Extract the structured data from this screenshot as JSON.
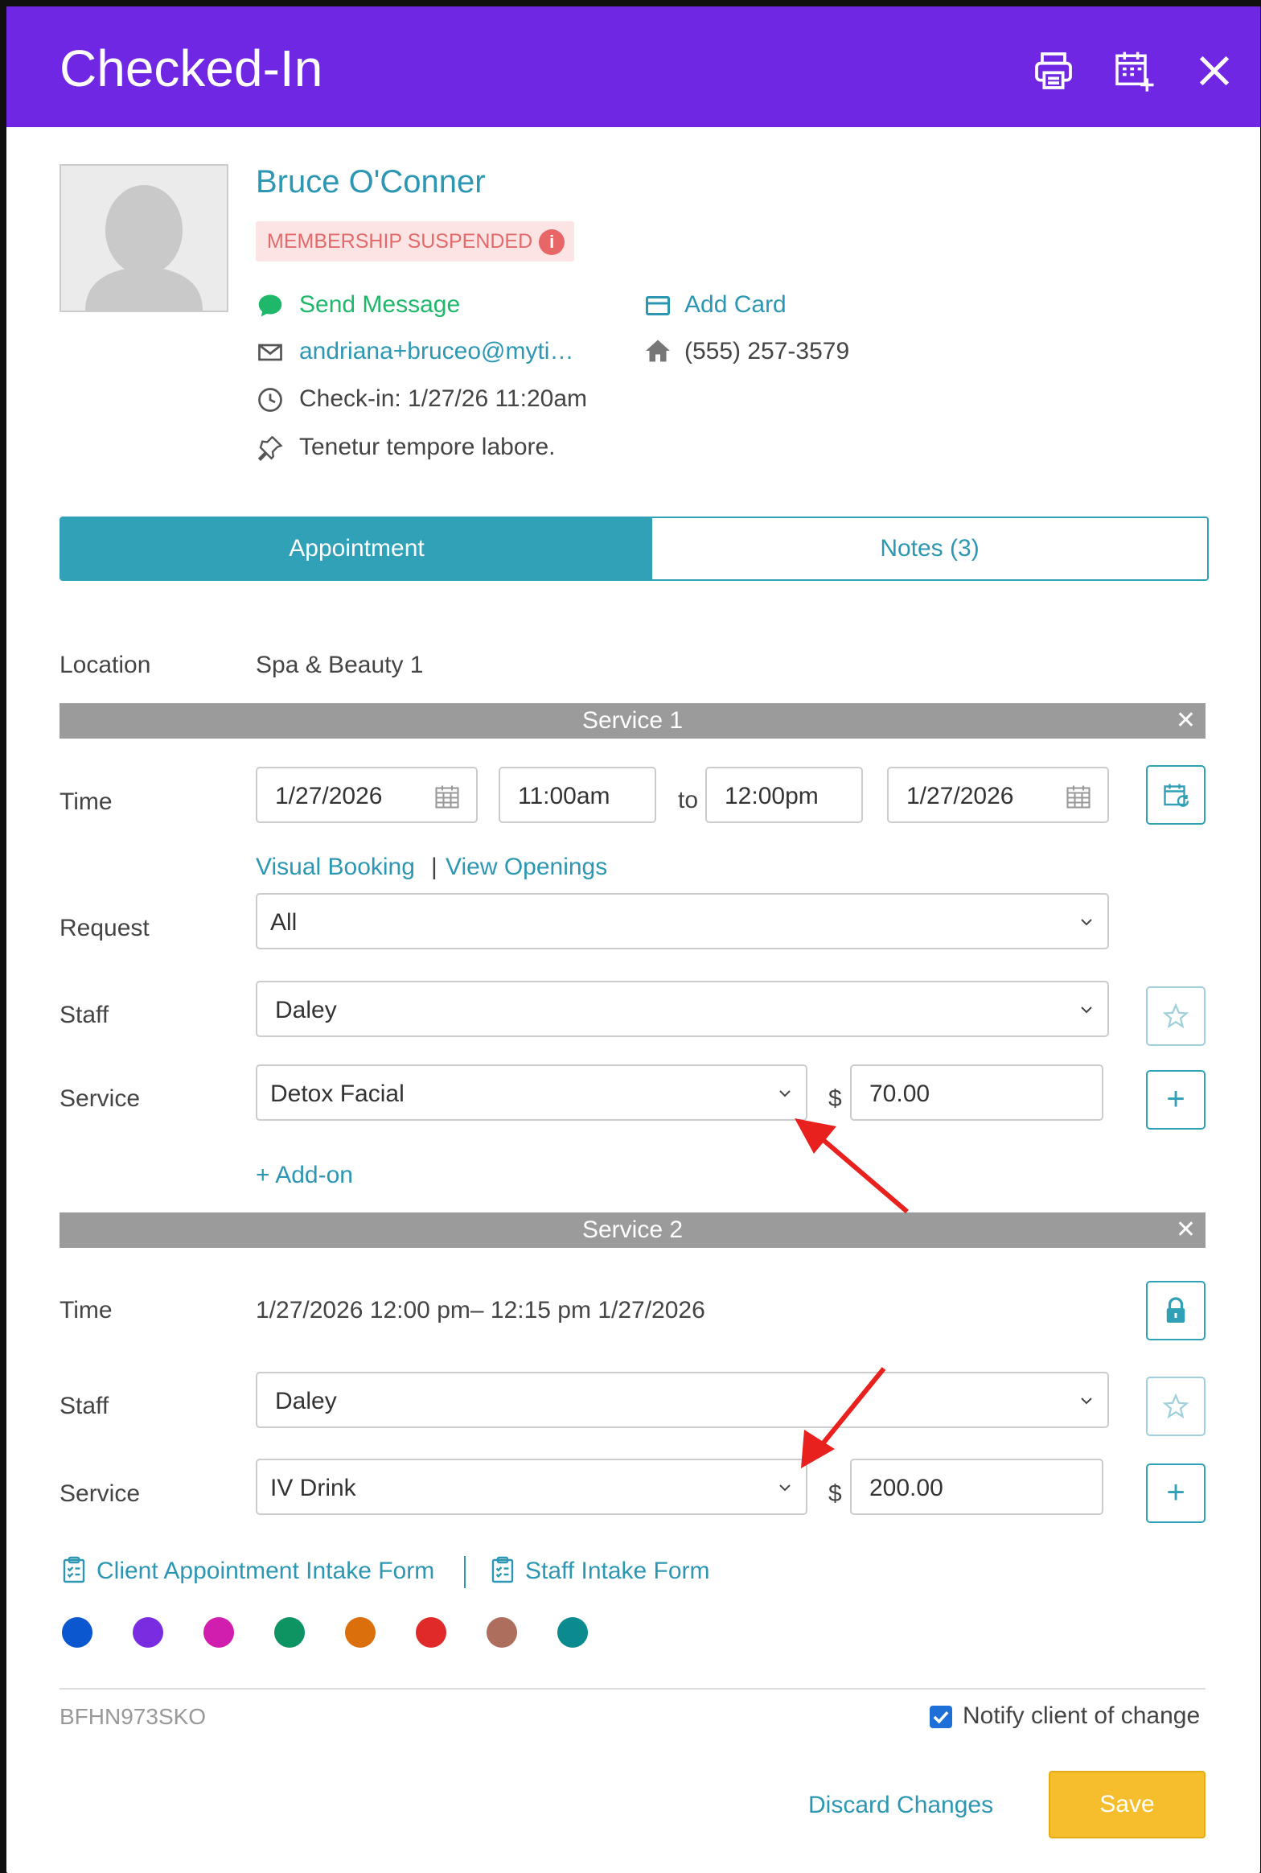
{
  "header": {
    "title": "Checked-In",
    "icons": [
      "printer-icon",
      "calendar-add-icon",
      "close-icon"
    ]
  },
  "client": {
    "name": "Bruce O'Conner",
    "badge": "MEMBERSHIP SUSPENDED",
    "send_message": "Send Message",
    "add_card": "Add Card",
    "email": "andriana+bruceo@myti…",
    "phone": "(555) 257-3579",
    "checkin": "Check-in: 1/27/26 11:20am",
    "note": "Tenetur tempore labore."
  },
  "tabs": {
    "appointment": "Appointment",
    "notes": "Notes (3)"
  },
  "location": {
    "label": "Location",
    "value": "Spa & Beauty 1"
  },
  "service1": {
    "bar": "Service 1",
    "time_label": "Time",
    "start_date": "1/27/2026",
    "start_time": "11:00am",
    "to": "to",
    "end_time": "12:00pm",
    "end_date": "1/27/2026",
    "visual_booking": "Visual Booking",
    "sep": "|",
    "view_openings": "View Openings",
    "request_label": "Request",
    "request_value": "All",
    "staff_label": "Staff",
    "staff_value": "Daley",
    "service_label": "Service",
    "service_value": "Detox Facial",
    "currency": "$",
    "price": "70.00",
    "addon": "+ Add-on"
  },
  "service2": {
    "bar": "Service 2",
    "time_label": "Time",
    "time_value": "1/27/2026 12:00 pm– 12:15 pm 1/27/2026",
    "staff_label": "Staff",
    "staff_value": "Daley",
    "service_label": "Service",
    "service_value": "IV Drink",
    "currency": "$",
    "price": "200.00"
  },
  "forms": {
    "client_intake": "Client Appointment Intake Form",
    "staff_intake": "Staff Intake Form"
  },
  "colors": [
    "#0B57D0",
    "#7A2CE0",
    "#D21EAE",
    "#0E9462",
    "#DB6F0C",
    "#E02A2A",
    "#AE6E5E",
    "#0B8A8F"
  ],
  "footer": {
    "code": "BFHN973SKO",
    "notify_label": "Notify client of change",
    "notify_checked": true,
    "discard": "Discard Changes",
    "save": "Save"
  }
}
